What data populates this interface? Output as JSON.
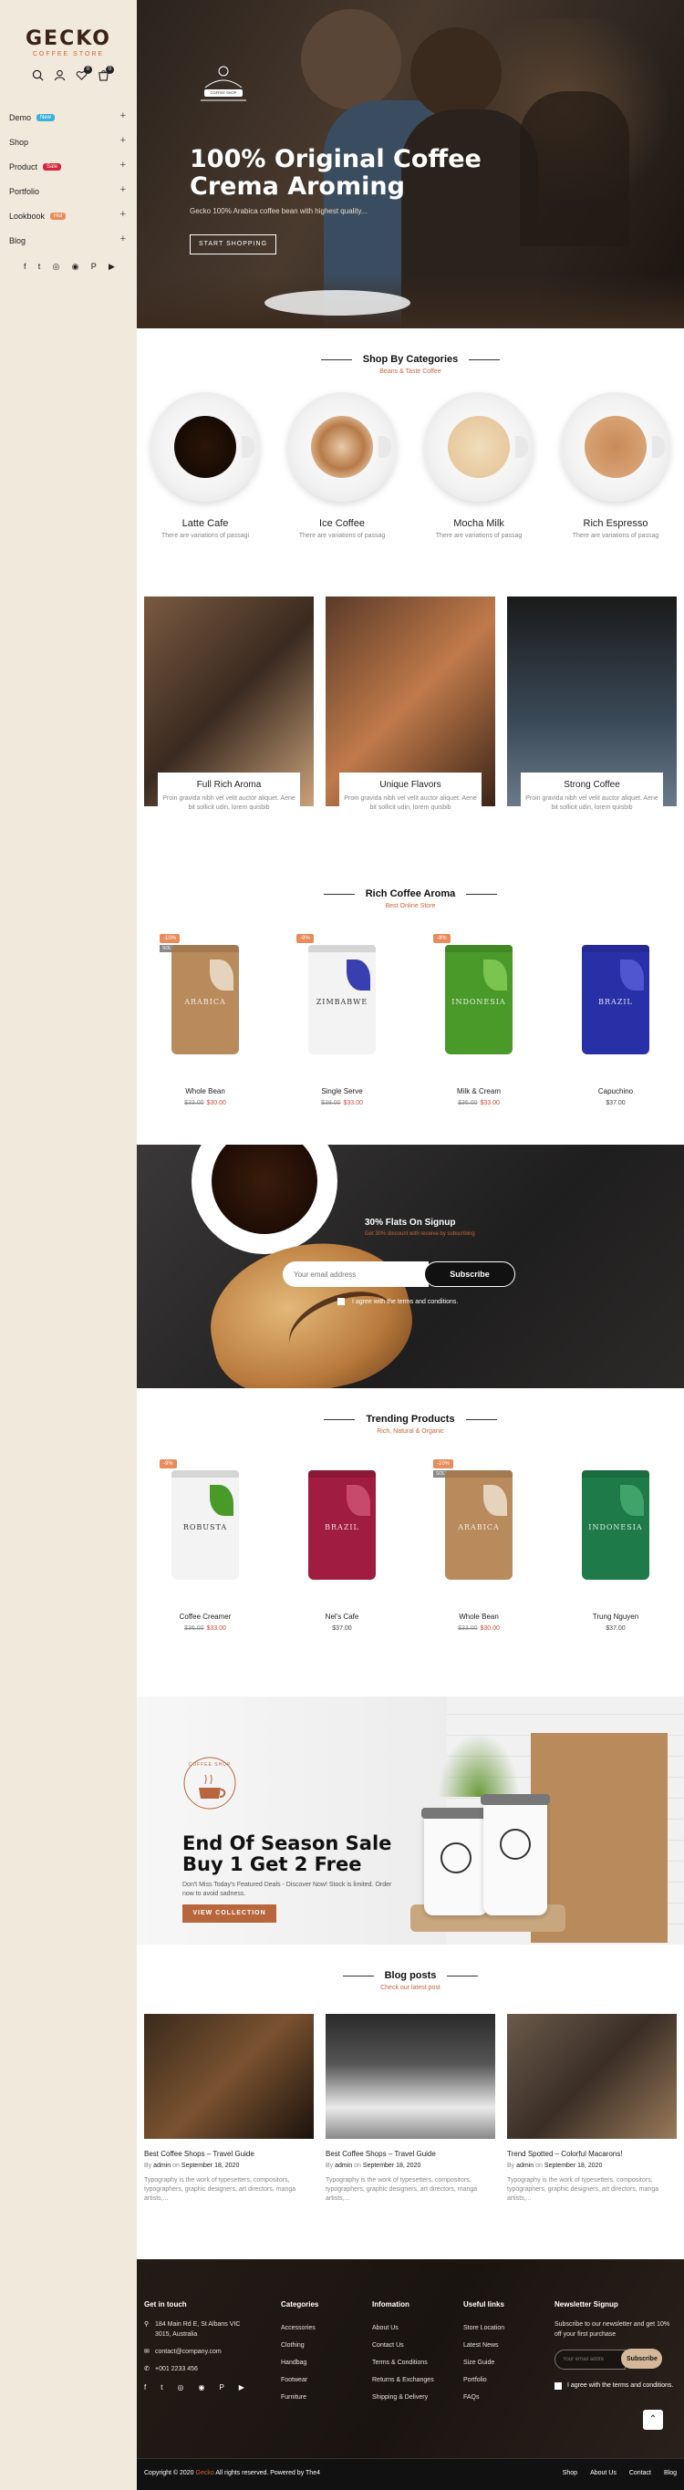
{
  "brand": {
    "name": "GECKO",
    "subtitle": "COFFEE STORE"
  },
  "header_icons": [
    "search-icon",
    "user-icon",
    "heart-icon",
    "cart-icon"
  ],
  "wishlist_count": "0",
  "cart_count": "0",
  "menu": [
    {
      "label": "Demo",
      "tag": "New",
      "tag_color": "#3bb0d9"
    },
    {
      "label": "Shop",
      "tag": "",
      "tag_color": ""
    },
    {
      "label": "Product",
      "tag": "Sale",
      "tag_color": "#d6253a"
    },
    {
      "label": "Portfolio",
      "tag": "",
      "tag_color": ""
    },
    {
      "label": "Lookbook",
      "tag": "Hot",
      "tag_color": "#e98b5a"
    },
    {
      "label": "Blog",
      "tag": "",
      "tag_color": ""
    }
  ],
  "social": [
    "f",
    "t",
    "◎",
    "◉",
    "P",
    "▶"
  ],
  "hero": {
    "title": "100% Original Coffee Crema Aroming",
    "subtitle": "Gecko 100% Arabica coffee bean with highest quality...",
    "button": "START SHOPPING",
    "badge": "COFFEE SHOP"
  },
  "categories": {
    "title": "Shop By Categories",
    "subtitle": "Beans & Taste Coffee",
    "items": [
      {
        "name": "Latte Cafe",
        "desc": "There are variations of passagi"
      },
      {
        "name": "Ice Coffee",
        "desc": "There are variations of passag"
      },
      {
        "name": "Mocha Milk",
        "desc": "There are variations of passag"
      },
      {
        "name": "Rich Espresso",
        "desc": "There are variations of passag"
      }
    ]
  },
  "features": [
    {
      "title": "Full Rich Aroma",
      "desc": "Proin gravida nibh vel velit auctor aliquet. Aene bit sollicit udin, lorem quisbib"
    },
    {
      "title": "Unique Flavors",
      "desc": "Proin gravida nibh vel velit auctor aliquet. Aene bit sollicit udin, lorem quisbib"
    },
    {
      "title": "Strong Coffee",
      "desc": "Proin gravida nibh vel velit auctor aliquet. Aene bit sollicit udin, lorem quisbib"
    }
  ],
  "rich_aroma": {
    "title": "Rich Coffee Aroma",
    "subtitle": "Best Online Store",
    "products": [
      {
        "name": "Whole Bean",
        "old": "$33.00",
        "new": "$30.00",
        "price": "",
        "discount": "-10%",
        "sold": "SOLD OUT",
        "label": "ARABICA",
        "color": "#b98a5c",
        "leaf": "#e6d3bd"
      },
      {
        "name": "Single Serve",
        "old": "$38.00",
        "new": "$33.00",
        "price": "",
        "discount": "-9%",
        "sold": "",
        "label": "ZIMBABWE",
        "color": "#f3f3f3",
        "leaf": "#3a3fb0"
      },
      {
        "name": "Milk & Cream",
        "old": "$36.00",
        "new": "$33.00",
        "price": "",
        "discount": "-8%",
        "sold": "",
        "label": "INDONESIA",
        "color": "#4a9a2a",
        "leaf": "#7cc450"
      },
      {
        "name": "Capuchino",
        "old": "",
        "new": "",
        "price": "$37.00",
        "discount": "",
        "sold": "",
        "label": "BRAZIL",
        "color": "#2830a8",
        "leaf": "#4e57d0"
      }
    ]
  },
  "signup": {
    "title": "30% Flats On Signup",
    "subtitle": "Get 30% discount with receive by subscribing",
    "placeholder": "Your email address",
    "button": "Subscribe",
    "agree": "I agree with the terms and conditions."
  },
  "trending": {
    "title": "Trending Products",
    "subtitle": "Rich, Natural & Organic",
    "products": [
      {
        "name": "Coffee Creamer",
        "old": "$36.00",
        "new": "$33.00",
        "price": "",
        "discount": "-9%",
        "sold": "",
        "label": "ROBUSTA",
        "color": "#f3f3f3",
        "leaf": "#4a9a2a"
      },
      {
        "name": "Nel's Cafe",
        "old": "",
        "new": "",
        "price": "$37.00",
        "discount": "",
        "sold": "",
        "label": "BRAZIL",
        "color": "#a01c40",
        "leaf": "#c84a6a"
      },
      {
        "name": "Whole Bean",
        "old": "$33.00",
        "new": "$30.00",
        "price": "",
        "discount": "-10%",
        "sold": "SOLD OUT",
        "label": "ARABICA",
        "color": "#b98a5c",
        "leaf": "#e6d3bd"
      },
      {
        "name": "Trung Nguyen",
        "old": "",
        "new": "",
        "price": "$37.00",
        "discount": "",
        "sold": "",
        "label": "INDONESIA",
        "color": "#1f7a4a",
        "leaf": "#3fa36a"
      }
    ]
  },
  "sale": {
    "logo": "COFFEE SHOP",
    "title": "End Of Season Sale Buy 1 Get 2 Free",
    "subtitle": "Don't Miss Today's Featured Deals - Discover Now! Stock is limited. Order now to avoid sadness.",
    "button": "VIEW COLLECTION"
  },
  "blog": {
    "title": "Blog posts",
    "subtitle": "Check our latest post",
    "posts": [
      {
        "title": "Best Coffee Shops – Travel Guide",
        "author": "admin",
        "date": "September 18, 2020",
        "excerpt": "Typography is the work of typesetters, compositors, typographers, graphic designers, art directors, manga artists,..."
      },
      {
        "title": "Best Coffee Shops – Travel Guide",
        "author": "admin",
        "date": "September 18, 2020",
        "excerpt": "Typography is the work of typesetters, compositors, typographers, graphic designers, art directors, manga artists,..."
      },
      {
        "title": "Trend Spotted – Colorful Macarons!",
        "author": "admin",
        "date": "September 18, 2020",
        "excerpt": "Typography is the work of typesetters, compositors, typographers, graphic designers, art directors, manga artists,..."
      }
    ],
    "by": "By",
    "on": "on"
  },
  "footer": {
    "contact_title": "Get in touch",
    "address": "184 Main Rd E, St Albans VIC 3015, Australia",
    "email": "contact@company.com",
    "phone": "+001 2233 456",
    "categories_title": "Categories",
    "categories": [
      "Accessories",
      "Clothing",
      "Handbag",
      "Footwear",
      "Furniture"
    ],
    "info_title": "Infomation",
    "info": [
      "About Us",
      "Contact Us",
      "Terms & Conditions",
      "Returns & Exchanges",
      "Shipping & Delivery"
    ],
    "links_title": "Useful links",
    "links": [
      "Store Location",
      "Latest News",
      "Size Guide",
      "Portfolio",
      "FAQs"
    ],
    "news_title": "Newsletter Signup",
    "news_text": "Subscribe to our newsletter and get 10% off your first purchase",
    "news_placeholder": "Your email addre",
    "news_button": "Subscribe",
    "news_agree": "I agree with the terms and conditions.",
    "copyright_a": "Copyright © 2020",
    "copyright_brand": "Gecko",
    "copyright_b": "All rights reserved. Powered by The4",
    "bottom_nav": [
      "Shop",
      "About Us",
      "Contact",
      "Blog"
    ]
  }
}
